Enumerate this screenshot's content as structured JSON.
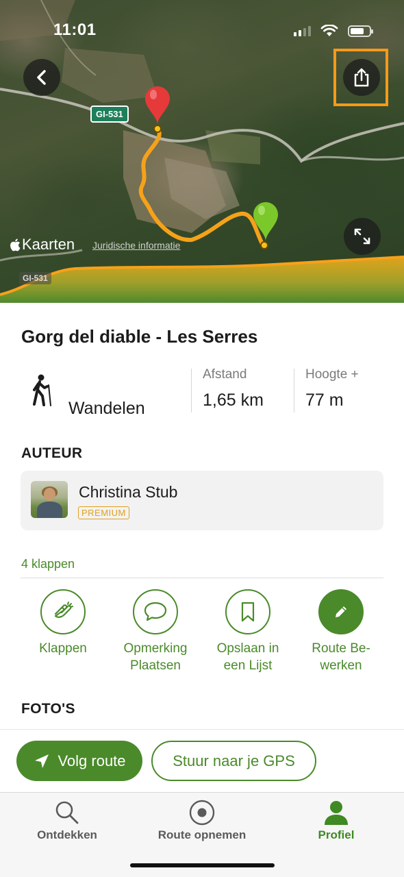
{
  "status_bar": {
    "time": "11:01"
  },
  "map": {
    "road_label": "GI-531",
    "road_label_2": "GI-531",
    "brand": "Kaarten",
    "legal_link": "Juridische informatie"
  },
  "route": {
    "title": "Gorg del diable - Les Serres",
    "activity": "Wandelen",
    "distance_label": "Afstand",
    "distance_value": "1,65 km",
    "elevation_label": "Hoogte +",
    "elevation_value": "77 m"
  },
  "author": {
    "heading": "AUTEUR",
    "name": "Christina Stub",
    "badge": "PREMIUM"
  },
  "claps": "4 klappen",
  "actions": [
    {
      "label": "Klappen",
      "icon": "clap-icon"
    },
    {
      "label": "Opmerking\nPlaatsen",
      "icon": "comment-icon"
    },
    {
      "label": "Opslaan in\neen Lijst",
      "icon": "bookmark-icon"
    },
    {
      "label": "Route Be-\nwerken",
      "icon": "pencil-icon"
    }
  ],
  "photos_heading": "FOTO'S",
  "cta": {
    "follow": "Volg route",
    "send_gps": "Stuur naar je GPS"
  },
  "tabs": [
    {
      "label": "Ontdekken",
      "icon": "search-icon"
    },
    {
      "label": "Route opnemen",
      "icon": "record-icon"
    },
    {
      "label": "Profiel",
      "icon": "profile-icon"
    }
  ],
  "colors": {
    "accent": "#4a8a2a",
    "premium": "#e0a11f",
    "highlight": "#f59a1a",
    "route_line": "#f5a21a"
  }
}
